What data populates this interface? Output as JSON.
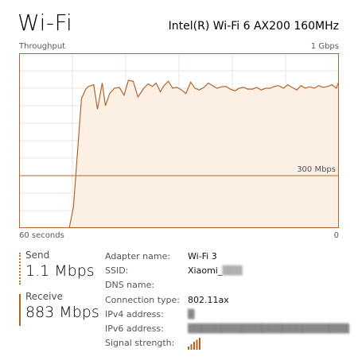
{
  "header": {
    "title": "Wi-Fi",
    "adapter_model": "Intel(R) Wi-Fi 6 AX200 160MHz"
  },
  "chart_data": {
    "type": "area",
    "title": "Throughput",
    "max_label": "1 Gbps",
    "mid_label": "300 Mbps",
    "x_left_label": "60 seconds",
    "x_right_label": "0",
    "unit": "Mbps",
    "ylim": [
      0,
      1000
    ],
    "xlim": [
      60,
      0
    ],
    "grid": true,
    "series": [
      {
        "x": [
          60,
          50.6,
          49.8,
          48.3,
          47.5,
          47.0,
          46.0,
          45.3,
          44.4,
          43.8,
          43.0,
          42.1,
          41.2,
          40.3,
          39.5,
          38.6,
          37.7,
          36.6,
          35.8,
          35.0,
          34.3,
          33.5,
          32.8,
          32.0,
          31.2,
          30.4,
          29.5,
          28.7,
          27.8,
          27.0,
          26.2,
          25.3,
          24.5,
          23.7,
          22.9,
          22.0,
          21.2,
          20.4,
          19.5,
          18.7,
          17.9,
          17.1,
          16.2,
          15.4,
          14.6,
          13.7,
          12.9,
          12.1,
          11.3,
          10.4,
          9.6,
          8.8,
          7.9,
          7.1,
          6.3,
          5.5,
          4.6,
          3.8,
          3.0,
          2.1,
          1.3,
          0.5,
          0
        ],
        "values": [
          0,
          0,
          120,
          740,
          795,
          810,
          820,
          680,
          830,
          700,
          770,
          800,
          805,
          760,
          845,
          840,
          750,
          800,
          825,
          810,
          830,
          780,
          815,
          840,
          800,
          805,
          790,
          770,
          835,
          800,
          790,
          805,
          830,
          815,
          800,
          808,
          810,
          795,
          785,
          800,
          805,
          795,
          795,
          805,
          790,
          800,
          800,
          810,
          815,
          800,
          820,
          805,
          790,
          815,
          800,
          808,
          800,
          815,
          805,
          810,
          820,
          800,
          840
        ]
      }
    ]
  },
  "send": {
    "label": "Send",
    "value": "1.1 Mbps"
  },
  "receive": {
    "label": "Receive",
    "value": "883 Mbps"
  },
  "details": [
    {
      "key": "Adapter name:",
      "value": "Wi-Fi 3"
    },
    {
      "key": "SSID:",
      "value": "Xiaomi_"
    },
    {
      "key": "DNS name:",
      "value": ""
    },
    {
      "key": "Connection type:",
      "value": "802.11ax"
    },
    {
      "key": "IPv4 address:",
      "value": ""
    },
    {
      "key": "IPv6 address:",
      "value": ""
    },
    {
      "key": "Signal strength:",
      "value": ""
    }
  ],
  "colors": {
    "accent": "#b76018",
    "line": "#b4652d",
    "fill": "#fcefe4",
    "grid": "#efe3d8"
  }
}
